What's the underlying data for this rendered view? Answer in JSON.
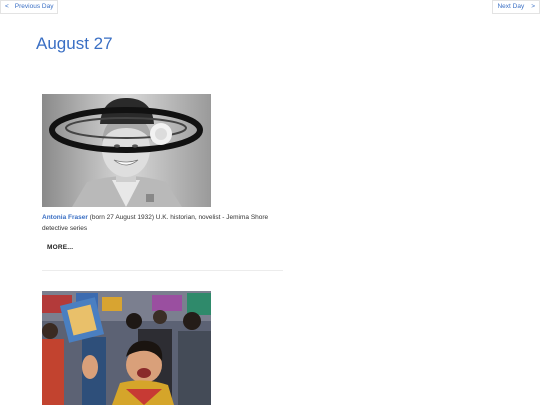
{
  "nav": {
    "prev_arrow": "<",
    "prev_label": "Previous Day",
    "next_label": "Next Day",
    "next_arrow": ">"
  },
  "page": {
    "title": "August 27"
  },
  "entries": [
    {
      "name": "Antonia Fraser",
      "description": " (born 27 August 1932) U.K. historian, novelist - Jemima Shore detective series",
      "more_label": "MORE..."
    }
  ]
}
